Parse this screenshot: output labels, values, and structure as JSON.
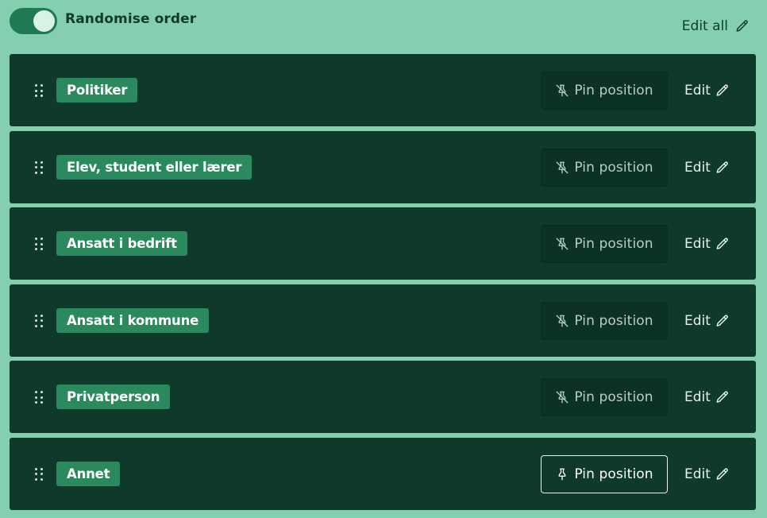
{
  "header": {
    "toggle_label": "Randomise order",
    "toggle_on": true,
    "edit_all_label": "Edit all"
  },
  "options": [
    {
      "label": "Politiker",
      "pin_label": "Pin position",
      "pinned": false,
      "edit_label": "Edit"
    },
    {
      "label": "Elev, student eller lærer",
      "pin_label": "Pin position",
      "pinned": false,
      "edit_label": "Edit"
    },
    {
      "label": "Ansatt i bedrift",
      "pin_label": "Pin position",
      "pinned": false,
      "edit_label": "Edit"
    },
    {
      "label": "Ansatt i kommune",
      "pin_label": "Pin position",
      "pinned": false,
      "edit_label": "Edit"
    },
    {
      "label": "Privatperson",
      "pin_label": "Pin position",
      "pinned": false,
      "edit_label": "Edit"
    },
    {
      "label": "Annet",
      "pin_label": "Pin position",
      "pinned": true,
      "edit_label": "Edit"
    }
  ],
  "icons": {
    "handle": "drag-handle-icon",
    "pin_off": "pin-off-icon",
    "pin_on": "pin-icon",
    "edit": "pencil-icon"
  },
  "colors": {
    "background": "#84cfaf",
    "row": "#0f3a2b",
    "tag": "#2a8a5e",
    "toggle": "#1f7a52"
  }
}
